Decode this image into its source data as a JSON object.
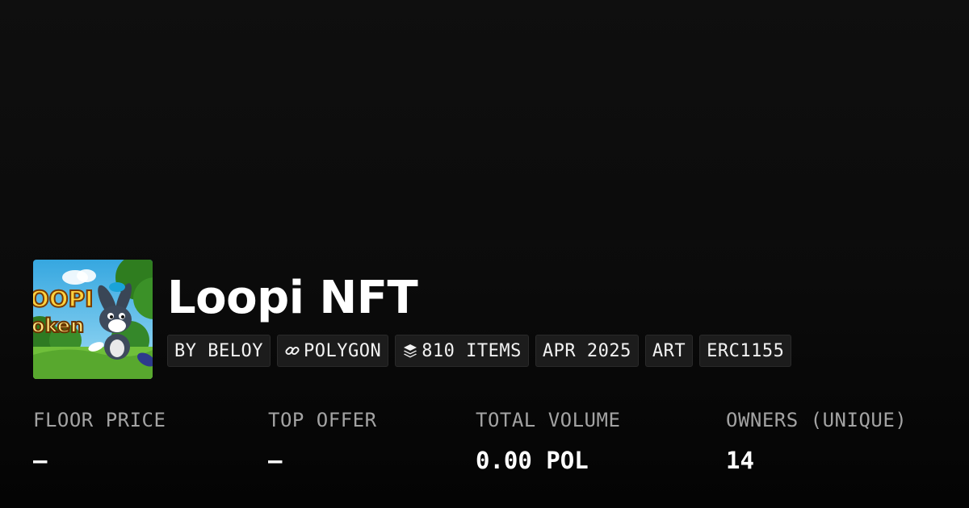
{
  "collection": {
    "title": "Loopi NFT",
    "thumbnail_text": [
      "OOPI",
      "oken"
    ],
    "tags": [
      {
        "label": "BY BELOY",
        "icon": null
      },
      {
        "label": "POLYGON",
        "icon": "link-icon"
      },
      {
        "label": "810 ITEMS",
        "icon": "layers-icon"
      },
      {
        "label": "APR 2025",
        "icon": null
      },
      {
        "label": "ART",
        "icon": null
      },
      {
        "label": "ERC1155",
        "icon": null
      }
    ]
  },
  "stats": [
    {
      "label": "FLOOR PRICE",
      "value": "–"
    },
    {
      "label": "TOP OFFER",
      "value": "–"
    },
    {
      "label": "TOTAL VOLUME",
      "value": "0.00 POL"
    },
    {
      "label": "OWNERS (UNIQUE)",
      "value": "14"
    }
  ],
  "colors": {
    "background": "#0b0b0b",
    "tag_background": "#1c1c1c",
    "label": "#a3a3a3",
    "value": "#ffffff"
  }
}
